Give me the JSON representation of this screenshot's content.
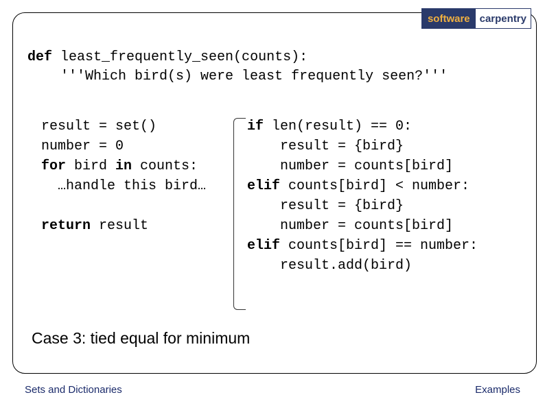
{
  "logo": {
    "left": "software",
    "right": "carpentry"
  },
  "code": {
    "defline": "def least_frequently_seen(counts):",
    "docstring": "    '''Which bird(s) were least frequently seen?'''"
  },
  "left": {
    "l1": "result = set()",
    "l2": "number = 0",
    "l3_pre": "for",
    "l3_mid": " bird ",
    "l3_in": "in",
    "l3_post": " counts:",
    "l4": "  …handle this bird…",
    "l5_pre": "return",
    "l5_post": " result"
  },
  "right": {
    "r1_pre": "if",
    "r1_post": " len(result) == 0:",
    "r2": "    result = {bird}",
    "r3": "    number = counts[bird]",
    "r4_pre": "elif",
    "r4_post": " counts[bird] < number:",
    "r5": "    result = {bird}",
    "r6": "    number = counts[bird]",
    "r7_pre": "elif",
    "r7_post": " counts[bird] == number:",
    "r8": "    result.add(bird)"
  },
  "caption": "Case 3: tied equal for minimum",
  "footer": {
    "left": "Sets and Dictionaries",
    "right": "Examples"
  }
}
